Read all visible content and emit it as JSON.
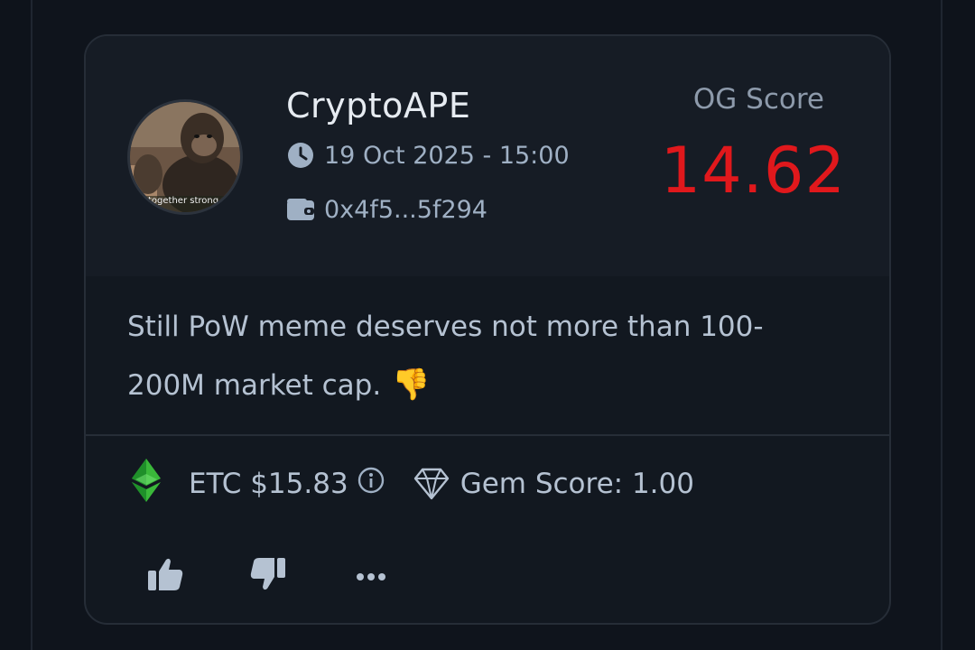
{
  "post": {
    "avatar": {
      "icon": "ape-avatar-image",
      "caption": "together strong"
    },
    "username": "CryptoAPE",
    "timestamp": "19 Oct 2025 - 15:00",
    "wallet": "0x4f5...5f294",
    "og_score": {
      "label": "OG Score",
      "value": "14.62",
      "color": "#e0181c"
    },
    "body": "Still PoW meme deserves not more than 100-200M market cap.",
    "emoji": "👎",
    "token": {
      "icon": "etc-logo-icon",
      "label": "ETC $15.83"
    },
    "gem_score": {
      "icon": "diamond-icon",
      "label": "Gem Score: 1.00"
    },
    "actions": [
      {
        "name": "like",
        "icon": "thumbs-up-icon"
      },
      {
        "name": "dislike",
        "icon": "thumbs-down-icon"
      },
      {
        "name": "more",
        "icon": "more-dots-icon"
      }
    ]
  },
  "colors": {
    "background": "#0e131b",
    "card": "#121820",
    "header": "#161c25",
    "text": "#b5c2d2",
    "muted": "#9fb0c4",
    "accent_red": "#e0181c"
  }
}
